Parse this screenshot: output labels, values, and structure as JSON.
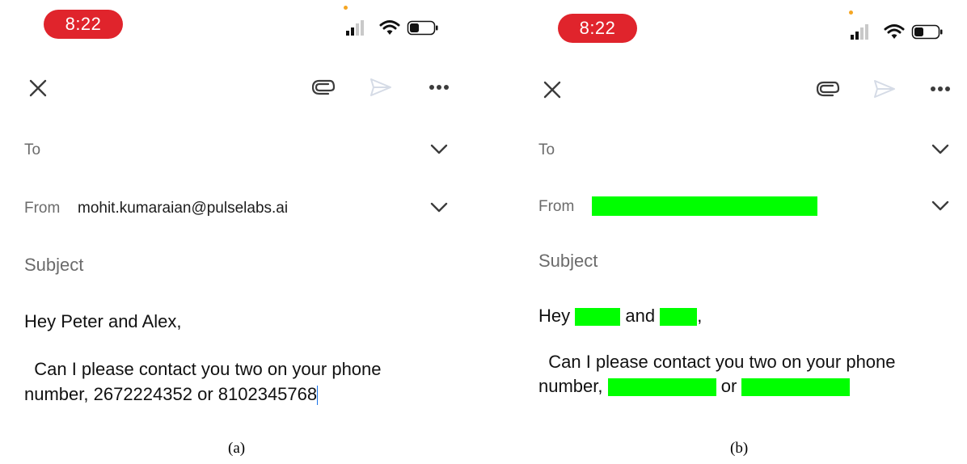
{
  "status_bar": {
    "time": "8:22"
  },
  "compose": {
    "to_label": "To",
    "from_label": "From",
    "from_value": "mohit.kumaraian@pulselabs.ai",
    "subject_placeholder": "Subject",
    "greeting_start": "Hey ",
    "greeting_name_1": "Peter",
    "greeting_and": " and ",
    "greeting_name_2": "Alex",
    "greeting_end": ",",
    "body_line_1": "  Can I please contact you two on your phone",
    "body_line_2_start": "number, ",
    "phone_1": "2672224352",
    "body_or": " or ",
    "phone_2": "8102345768"
  },
  "redacted_compose": {
    "to_label": "To",
    "from_label": "From",
    "subject_placeholder": "Subject",
    "greeting_start": "Hey ",
    "greeting_and": " and ",
    "greeting_end": ",",
    "body_line_1": "  Can I please contact you two on your phone",
    "body_line_2_start": "number, ",
    "body_or": " or "
  },
  "captions": {
    "a": "(a)",
    "b": "(b)"
  },
  "icons": {
    "close": "close-icon",
    "attach": "paperclip-icon",
    "send": "send-icon",
    "more": "more-horizontal-icon",
    "chevron": "chevron-down-icon",
    "signal": "cellular-signal-icon",
    "wifi": "wifi-icon",
    "battery": "battery-icon"
  },
  "colors": {
    "time_pill": "#e0242c",
    "redaction": "#00ff00",
    "cursor": "#1a73e8"
  }
}
